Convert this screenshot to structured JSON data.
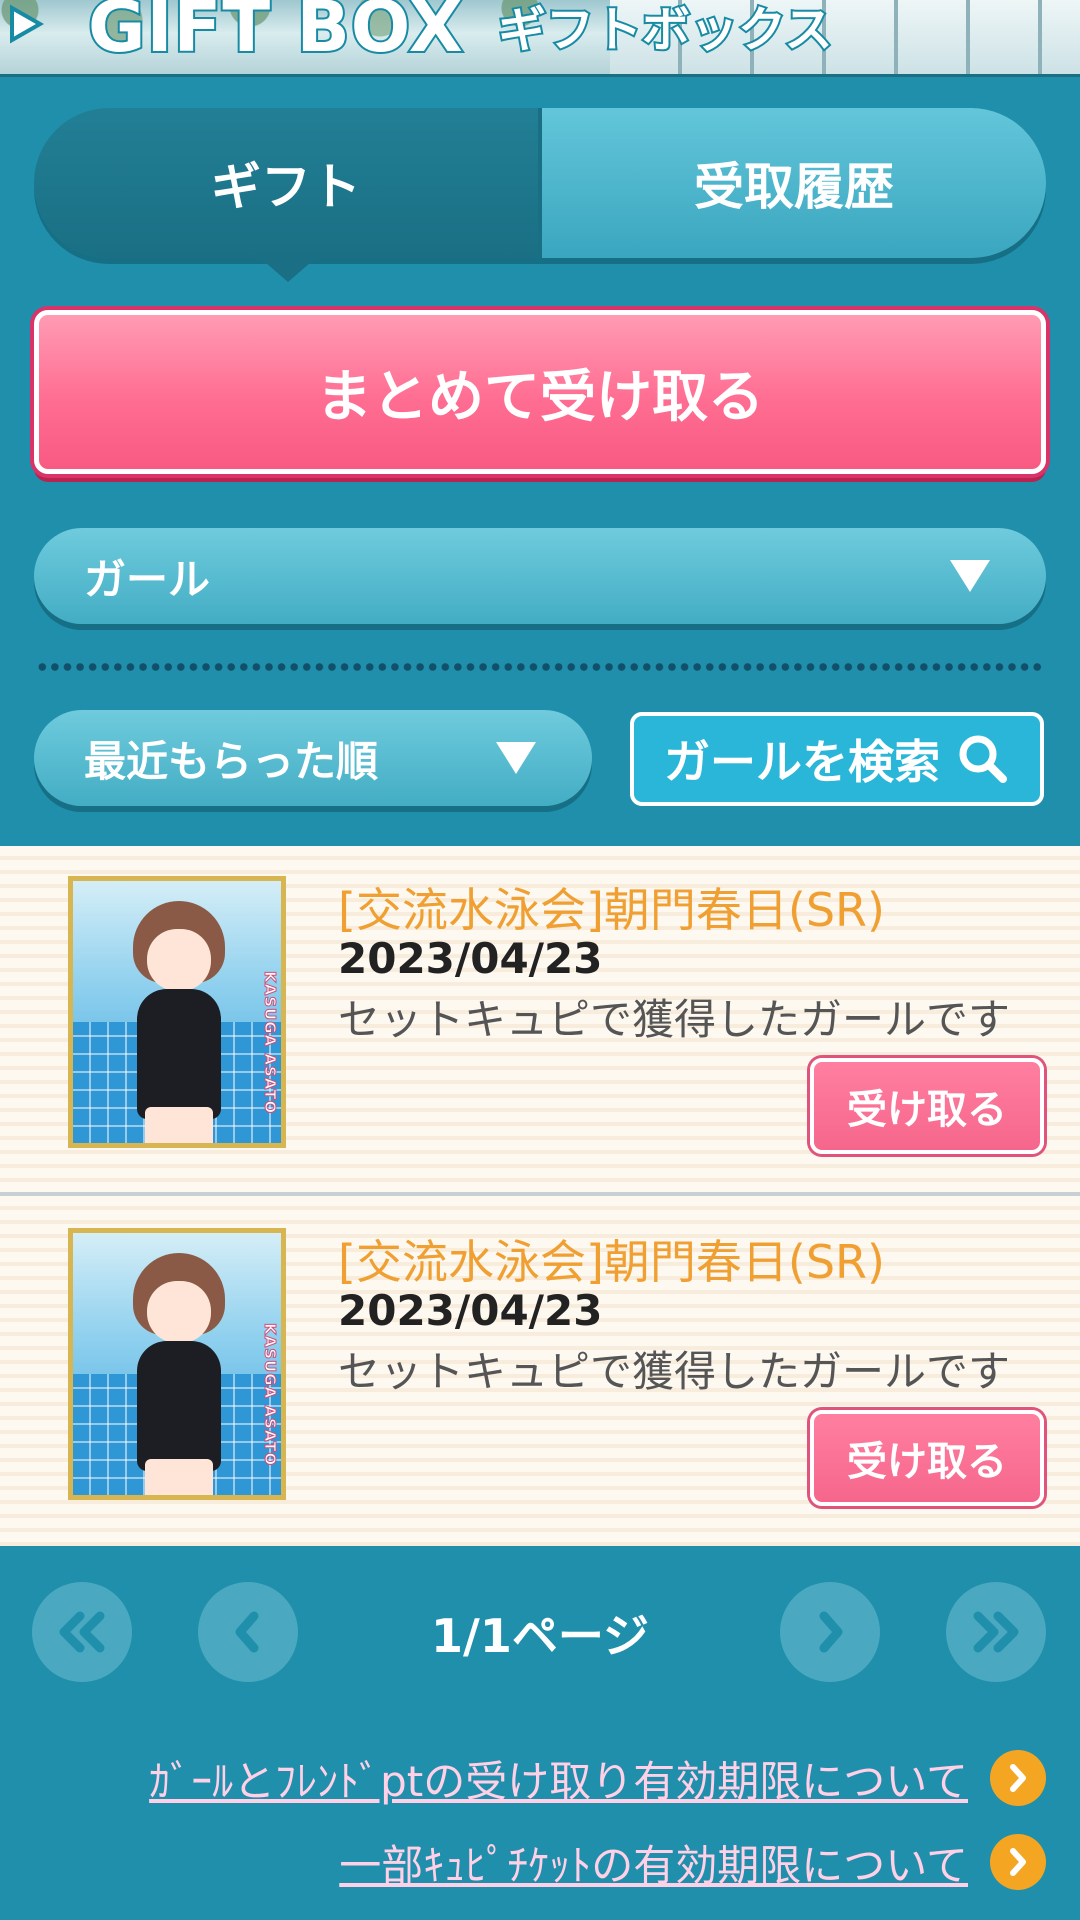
{
  "header": {
    "title": "GIFT BOX",
    "subtitle": "ギフトボックス"
  },
  "tabs": [
    {
      "label": "ギフト",
      "active": true
    },
    {
      "label": "受取履歴",
      "active": false
    }
  ],
  "receive_all_label": "まとめて受け取る",
  "filter": {
    "category_selected": "ガール",
    "sort_selected": "最近もらった順",
    "search_label": "ガールを検索"
  },
  "items": [
    {
      "title": "[交流水泳会]朝門春日(SR)",
      "date": "2023/04/23",
      "description": "セットキュピで獲得したガールです",
      "button": "受け取る",
      "card_name": "KASUGA ASATO"
    },
    {
      "title": "[交流水泳会]朝門春日(SR)",
      "date": "2023/04/23",
      "description": "セットキュピで獲得したガールです",
      "button": "受け取る",
      "card_name": "KASUGA ASATO"
    }
  ],
  "pagination": {
    "label": "1/1ページ",
    "icons": [
      "first-page-icon",
      "prev-page-icon",
      "next-page-icon",
      "last-page-icon"
    ]
  },
  "footer_links": [
    "ｶﾞｰﾙとﾌﾚﾝﾄﾞptの受け取り有効期限について",
    "一部ｷｭﾋﾟﾁｹｯﾄの有効期限について"
  ],
  "colors": {
    "background": "#1f8fab",
    "accent_pink": "#ff6d92",
    "title_orange": "#f0a033",
    "link_pink": "#ffd0e6"
  }
}
